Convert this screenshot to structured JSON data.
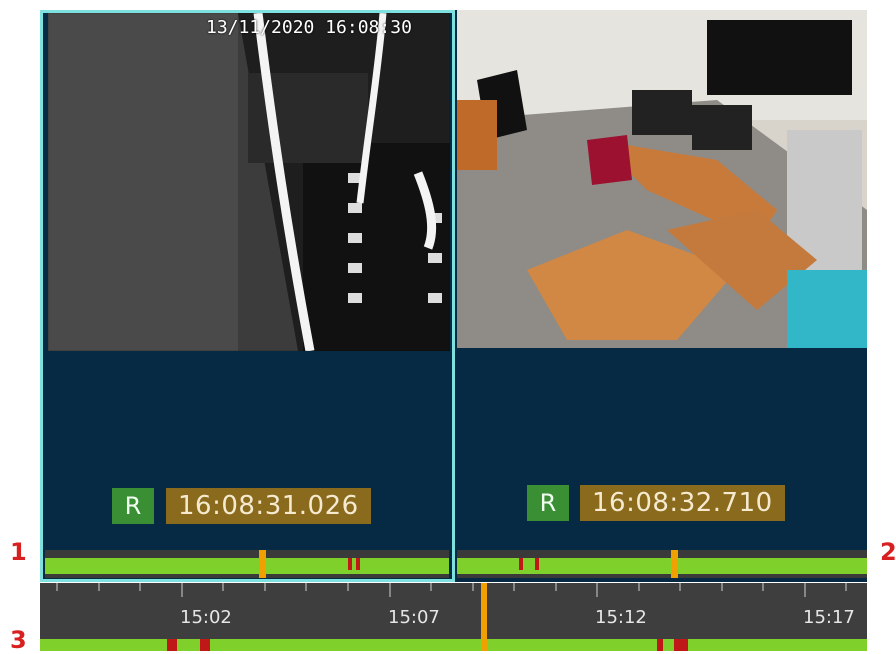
{
  "cameras": [
    {
      "overlay_timestamp": "13/11/2020  16:08:30",
      "badge_mode": "R",
      "playback_time": "16:08:31.026",
      "label_number": "1"
    },
    {
      "badge_mode": "R",
      "playback_time": "16:08:32.710",
      "label_number": "2"
    }
  ],
  "timeline": {
    "label_number": "3",
    "tick_labels": [
      "15:02",
      "15:07",
      "15:12",
      "15:17"
    ]
  },
  "colors": {
    "selected_border": "#7fe0e0",
    "panel_background": "#062a44",
    "track_green": "#7fd02a",
    "event_red": "#c01818",
    "cursor_orange": "#f0a000",
    "badge_green": "#3a8e34",
    "badge_gold": "#8a6a1c"
  }
}
